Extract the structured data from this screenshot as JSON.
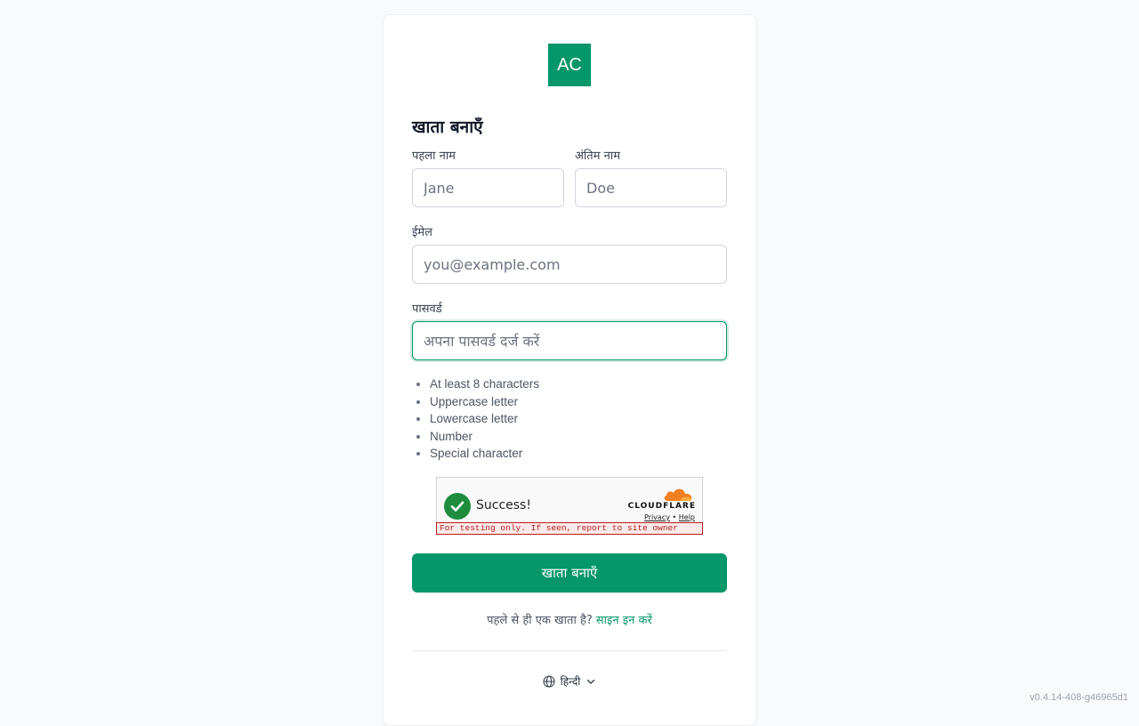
{
  "logo": {
    "text": "AC"
  },
  "form": {
    "title": "खाता बनाएँ",
    "first_name": {
      "label": "पहला नाम",
      "placeholder": "Jane",
      "value": ""
    },
    "last_name": {
      "label": "अंतिम नाम",
      "placeholder": "Doe",
      "value": ""
    },
    "email": {
      "label": "ईमेल",
      "placeholder": "you@example.com",
      "value": ""
    },
    "password": {
      "label": "पासवर्ड",
      "placeholder": "अपना पासवर्ड दर्ज करें",
      "value": ""
    },
    "password_rules": [
      "At least 8 characters",
      "Uppercase letter",
      "Lowercase letter",
      "Number",
      "Special character"
    ],
    "submit_label": "खाता बनाएँ"
  },
  "captcha": {
    "status": "Success!",
    "brand": "CLOUDFLARE",
    "privacy_link": "Privacy",
    "separator": "•",
    "help_link": "Help",
    "warning": "For testing only. If seen, report to site owner"
  },
  "signin": {
    "prompt": "पहले से ही एक खाता है?",
    "link": "साइन इन करें"
  },
  "language": {
    "selected": "हिन्दी"
  },
  "version": "v0.4.14-408-g46965d1",
  "colors": {
    "accent": "#059669",
    "captcha_success": "#1e8e3e",
    "captcha_warning": "#b91c1c"
  }
}
